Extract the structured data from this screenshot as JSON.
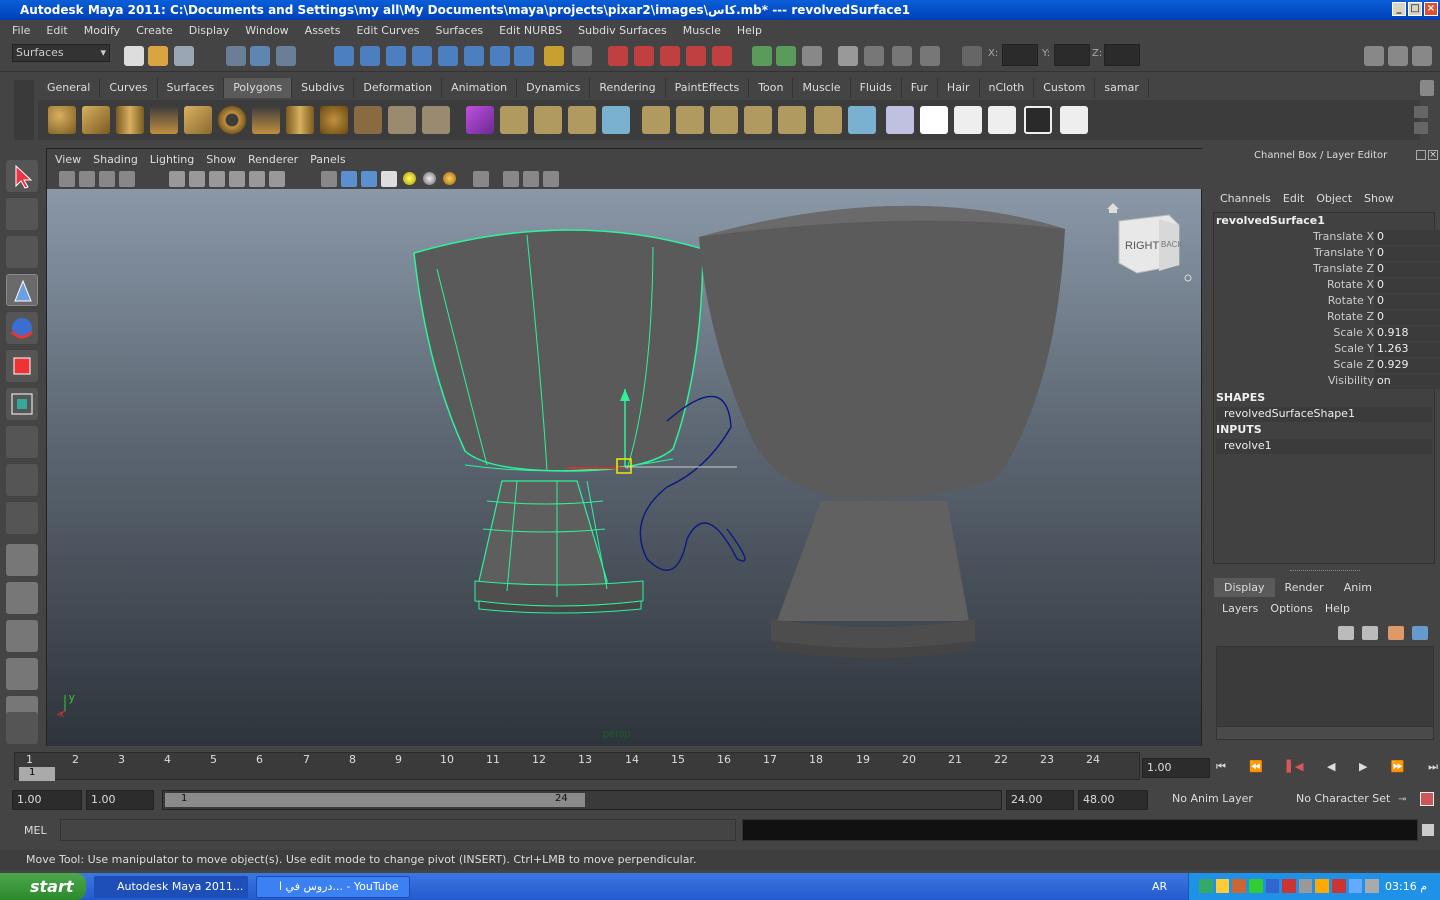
{
  "window": {
    "title": "Autodesk Maya 2011: C:\\Documents and Settings\\my all\\My Documents\\maya\\projects\\pixar2\\images\\كاس.mb*  ---  revolvedSurface1"
  },
  "menubar": {
    "items": [
      "File",
      "Edit",
      "Modify",
      "Create",
      "Display",
      "Window",
      "Assets",
      "Edit Curves",
      "Surfaces",
      "Edit NURBS",
      "Subdiv Surfaces",
      "Muscle",
      "Help"
    ]
  },
  "statusline": {
    "menu_set": "Surfaces",
    "x_label": "X:",
    "y_label": "Y:",
    "z_label": "Z:"
  },
  "shelf": {
    "tabs": [
      "General",
      "Curves",
      "Surfaces",
      "Polygons",
      "Subdivs",
      "Deformation",
      "Animation",
      "Dynamics",
      "Rendering",
      "PaintEffects",
      "Toon",
      "Muscle",
      "Fluids",
      "Fur",
      "Hair",
      "nCloth",
      "Custom",
      "samar"
    ],
    "active_tab": "Polygons"
  },
  "viewport": {
    "menu": [
      "View",
      "Shading",
      "Lighting",
      "Show",
      "Renderer",
      "Panels"
    ],
    "camera_label": "persp",
    "viewcube": {
      "face_right": "RIGHT",
      "face_back": "BACK"
    },
    "axis": {
      "x": "x",
      "y": "y"
    }
  },
  "channelbox": {
    "title": "Channel Box / Layer Editor",
    "menu": [
      "Channels",
      "Edit",
      "Object",
      "Show"
    ],
    "object": "revolvedSurface1",
    "channels": [
      {
        "label": "Translate X",
        "value": "0"
      },
      {
        "label": "Translate Y",
        "value": "0"
      },
      {
        "label": "Translate Z",
        "value": "0"
      },
      {
        "label": "Rotate X",
        "value": "0"
      },
      {
        "label": "Rotate Y",
        "value": "0"
      },
      {
        "label": "Rotate Z",
        "value": "0"
      },
      {
        "label": "Scale X",
        "value": "0.918"
      },
      {
        "label": "Scale Y",
        "value": "1.263"
      },
      {
        "label": "Scale Z",
        "value": "0.929"
      },
      {
        "label": "Visibility",
        "value": "on"
      }
    ],
    "shapes_header": "SHAPES",
    "shape": "revolvedSurfaceShape1",
    "inputs_header": "INPUTS",
    "input": "revolve1",
    "layer_tabs": [
      "Display",
      "Render",
      "Anim"
    ],
    "layer_menu": [
      "Layers",
      "Options",
      "Help"
    ]
  },
  "timeline": {
    "ticks": [
      "1",
      "2",
      "3",
      "4",
      "5",
      "6",
      "7",
      "8",
      "9",
      "10",
      "11",
      "12",
      "13",
      "14",
      "15",
      "16",
      "17",
      "18",
      "19",
      "20",
      "21",
      "22",
      "23",
      "24"
    ],
    "current_frame": "1.00",
    "cursor": "1"
  },
  "range": {
    "start": "1.00",
    "playback_start": "1.00",
    "slider_start": "1",
    "slider_end": "24",
    "playback_end": "24.00",
    "end": "48.00",
    "anim_layer": "No Anim Layer",
    "char_set": "No Character Set"
  },
  "cmdline": {
    "label": "MEL"
  },
  "helpline": {
    "text": "Move Tool: Use manipulator to move object(s). Use edit mode to change pivot (INSERT).  Ctrl+LMB to move perpendicular."
  },
  "taskbar": {
    "start": "start",
    "tasks": [
      "Autodesk Maya 2011...",
      "دروس في ا... - YouTube"
    ],
    "lang": "AR",
    "clock": "03:16 م"
  }
}
